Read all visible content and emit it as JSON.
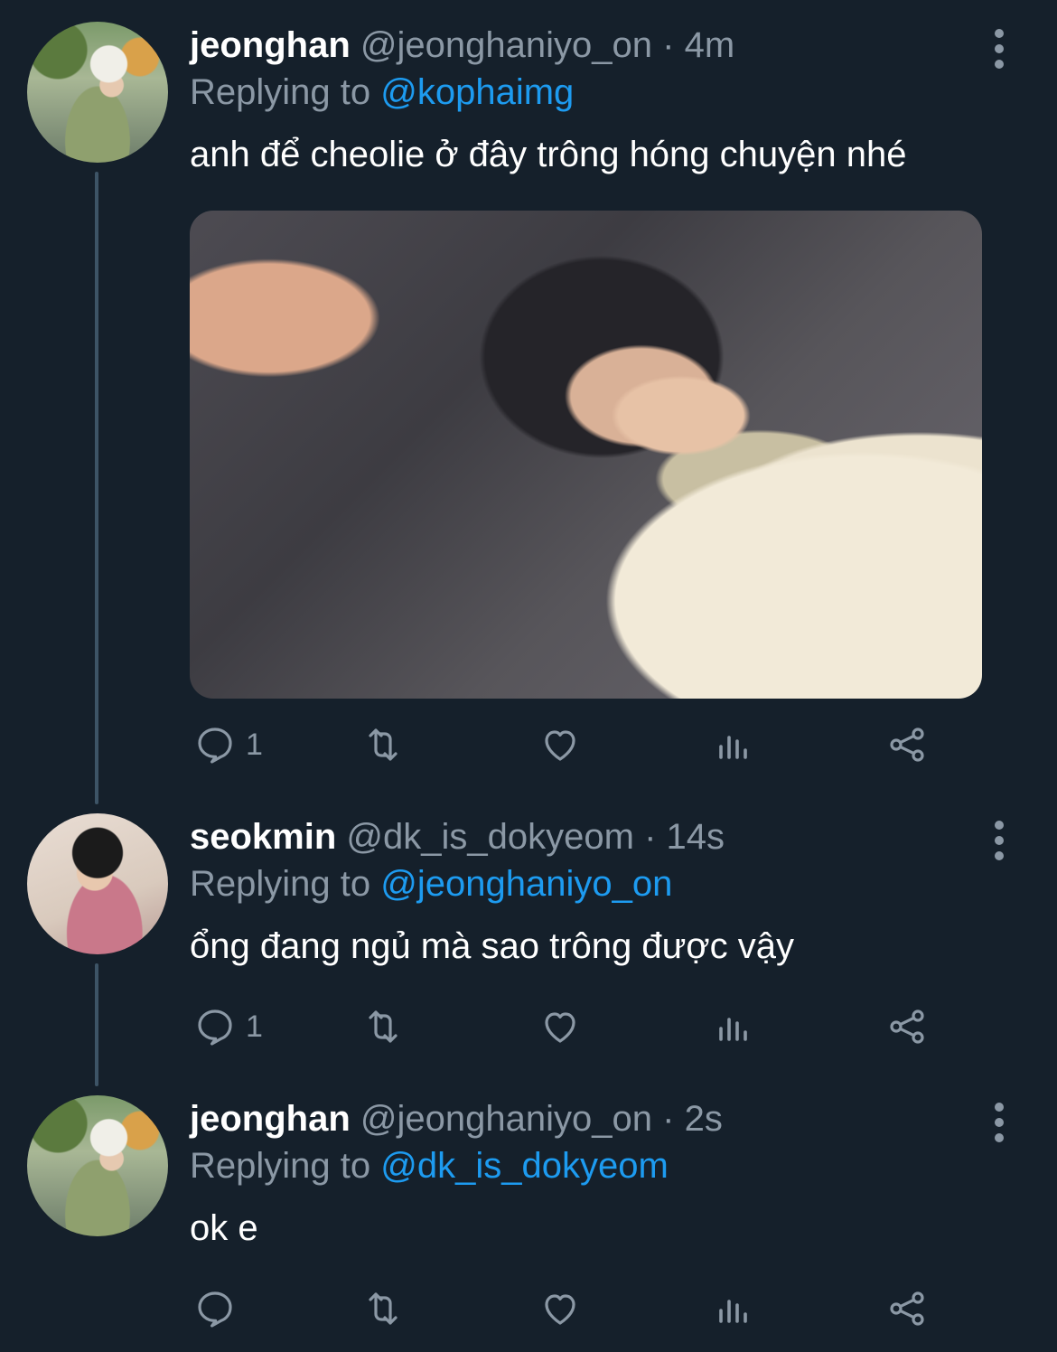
{
  "tweets": [
    {
      "name": "jeonghan",
      "handle": "@jeonghaniyo_on",
      "separator": "·",
      "time": "4m",
      "replying_prefix": "Replying to ",
      "replying_to": "@kophaimg",
      "text": "anh để cheolie ở đây trông hóng chuyện nhé",
      "has_media": true,
      "reply_count": "1"
    },
    {
      "name": "seokmin",
      "handle": "@dk_is_dokyeom",
      "separator": "·",
      "time": "14s",
      "replying_prefix": "Replying to ",
      "replying_to": "@jeonghaniyo_on",
      "text": "ổng đang ngủ mà sao trông được vậy",
      "has_media": false,
      "reply_count": "1"
    },
    {
      "name": "jeonghan",
      "handle": "@jeonghaniyo_on",
      "separator": "·",
      "time": "2s",
      "replying_prefix": "Replying to ",
      "replying_to": "@dk_is_dokyeom",
      "text": "ok e",
      "has_media": false,
      "reply_count": ""
    }
  ],
  "icons": {
    "reply": "reply-icon",
    "retweet": "retweet-icon",
    "like": "heart-icon",
    "views": "views-icon",
    "share": "share-icon",
    "more": "more-icon"
  },
  "colors": {
    "background": "#15202b",
    "text": "#ffffff",
    "secondary": "#8b98a5",
    "accent": "#1d9bf0"
  }
}
